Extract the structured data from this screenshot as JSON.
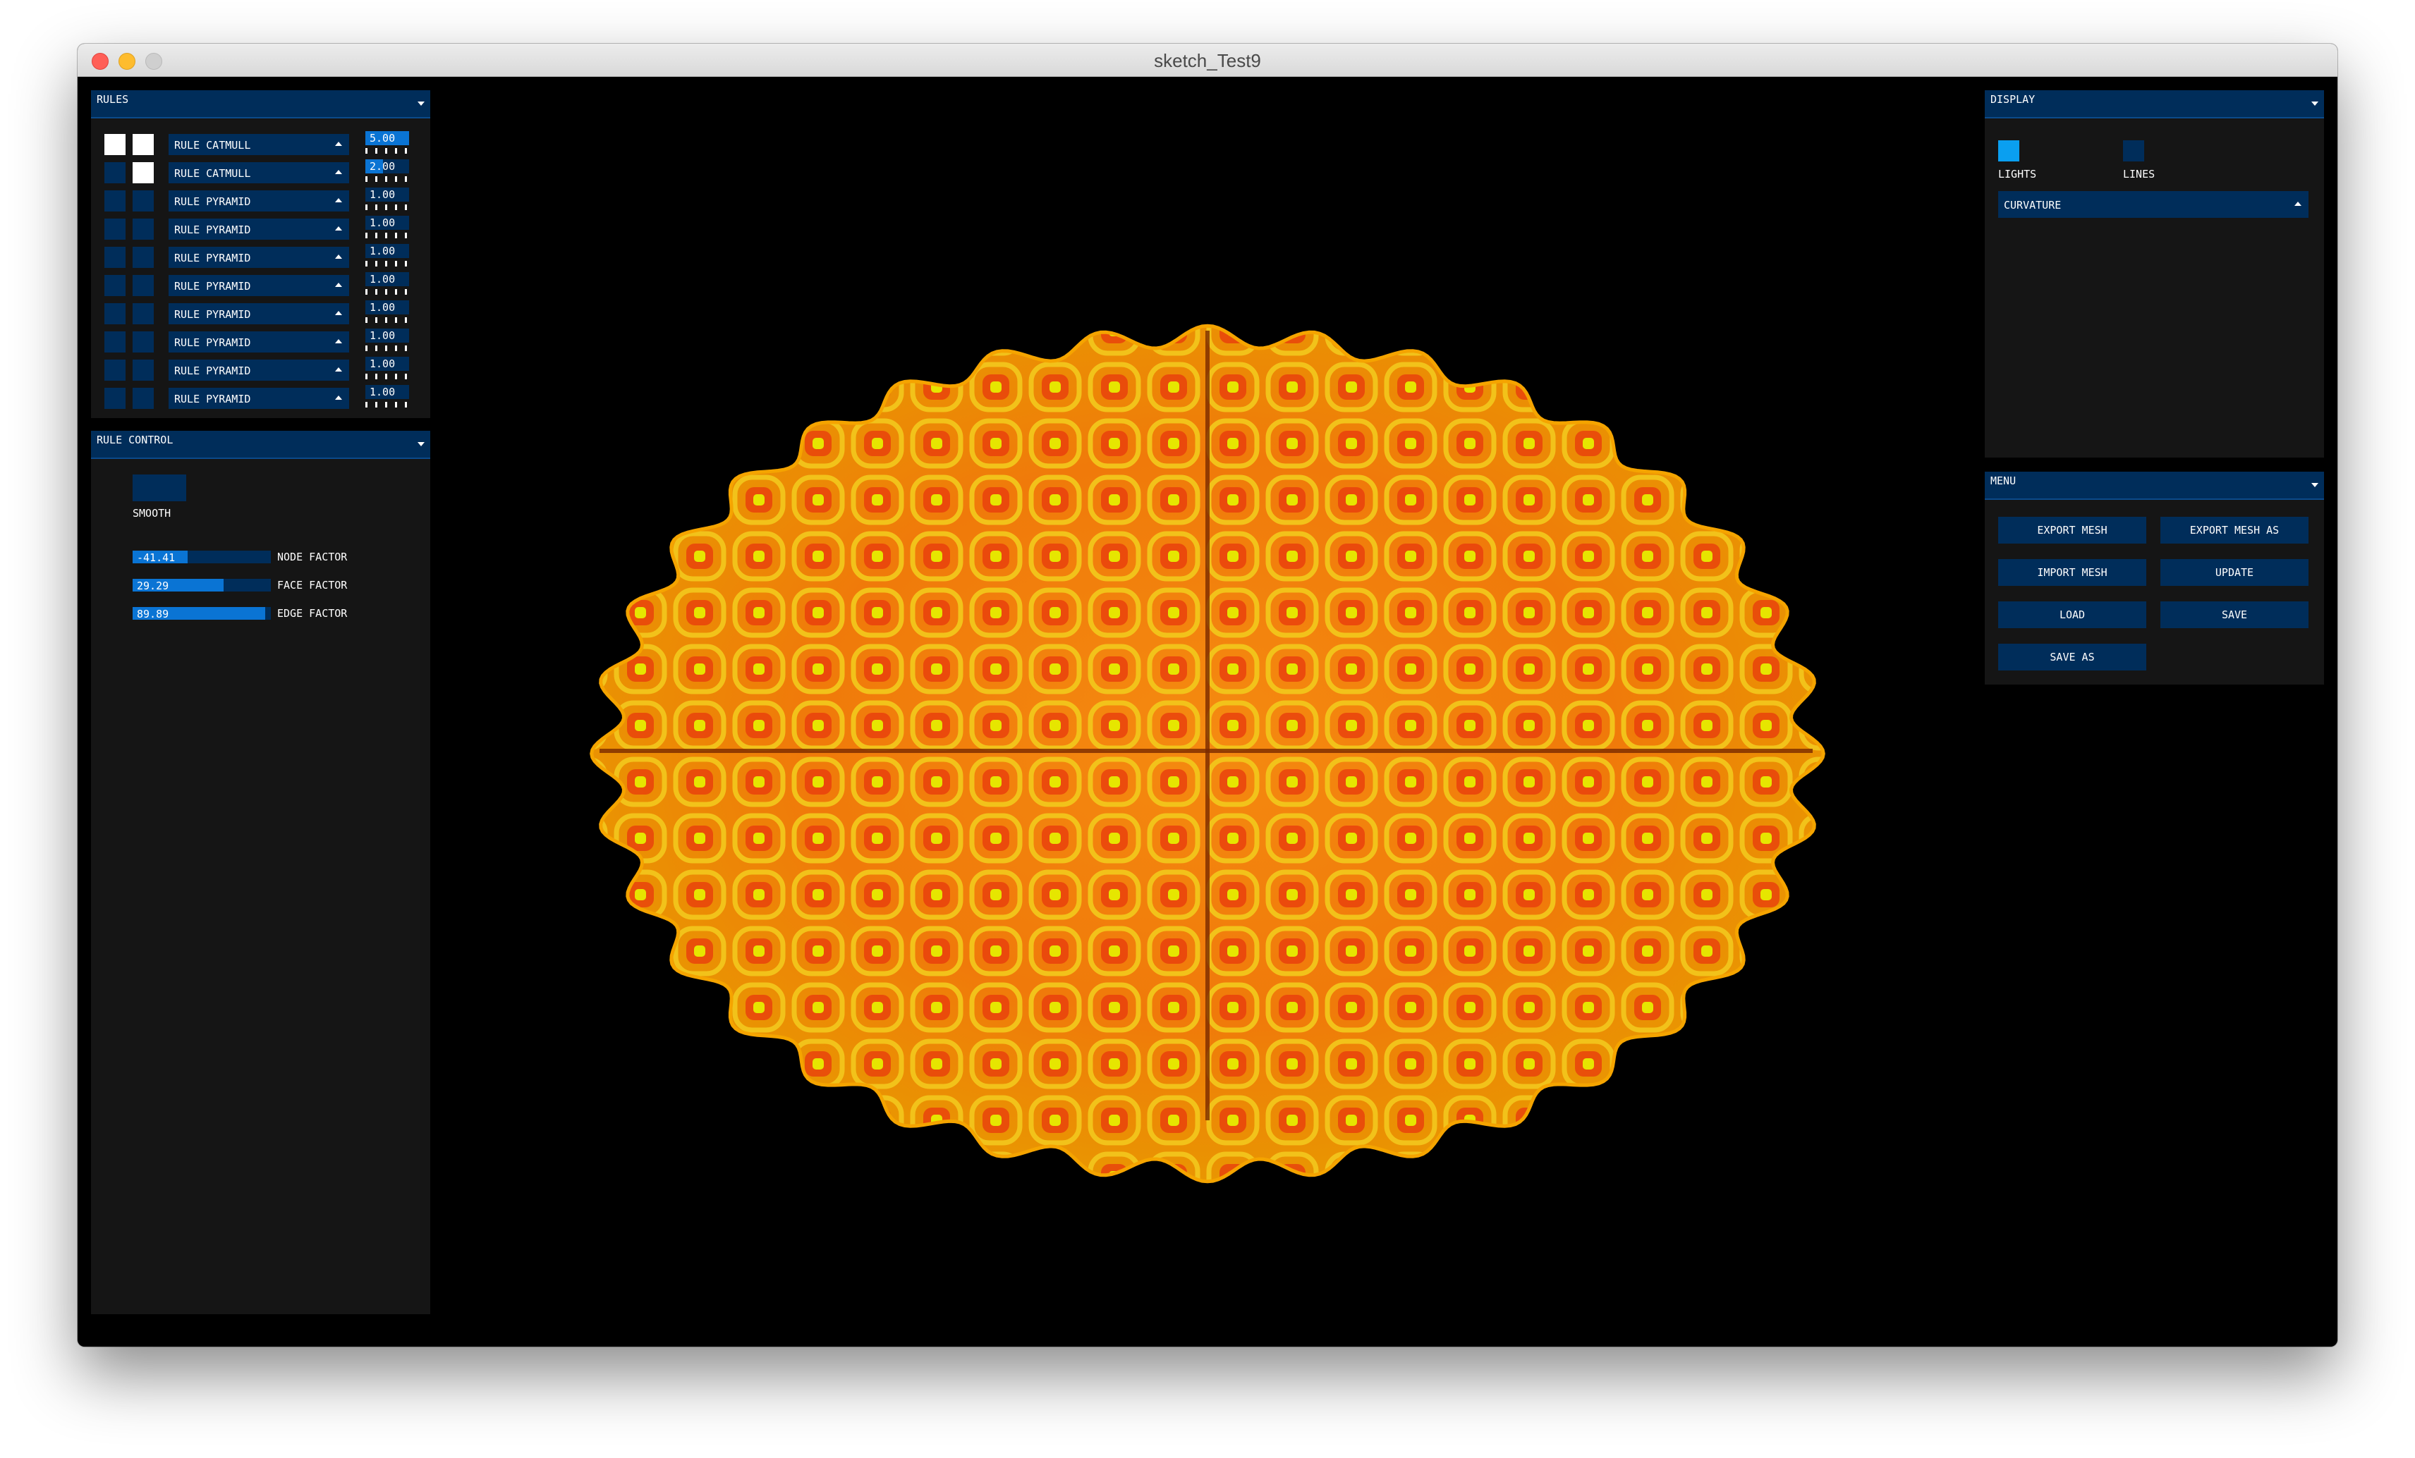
{
  "window": {
    "title": "sketch_Test9"
  },
  "rules_panel": {
    "header": "RULES",
    "rows": [
      {
        "check_a": true,
        "check_b": true,
        "rule": "RULE CATMULL",
        "value": "5.00",
        "fill": 1.0
      },
      {
        "check_a": false,
        "check_b": true,
        "rule": "RULE CATMULL",
        "value": "2.00",
        "fill": 0.4
      },
      {
        "check_a": false,
        "check_b": false,
        "rule": "RULE PYRAMID",
        "value": "1.00",
        "fill": 0.0
      },
      {
        "check_a": false,
        "check_b": false,
        "rule": "RULE PYRAMID",
        "value": "1.00",
        "fill": 0.0
      },
      {
        "check_a": false,
        "check_b": false,
        "rule": "RULE PYRAMID",
        "value": "1.00",
        "fill": 0.0
      },
      {
        "check_a": false,
        "check_b": false,
        "rule": "RULE PYRAMID",
        "value": "1.00",
        "fill": 0.0
      },
      {
        "check_a": false,
        "check_b": false,
        "rule": "RULE PYRAMID",
        "value": "1.00",
        "fill": 0.0
      },
      {
        "check_a": false,
        "check_b": false,
        "rule": "RULE PYRAMID",
        "value": "1.00",
        "fill": 0.0
      },
      {
        "check_a": false,
        "check_b": false,
        "rule": "RULE PYRAMID",
        "value": "1.00",
        "fill": 0.0
      },
      {
        "check_a": false,
        "check_b": false,
        "rule": "RULE PYRAMID",
        "value": "1.00",
        "fill": 0.0
      }
    ]
  },
  "rule_control": {
    "header": "RULE CONTROL",
    "smooth_label": "SMOOTH",
    "sliders": [
      {
        "value": "-41.41",
        "label": "NODE FACTOR",
        "fill": 0.4
      },
      {
        "value": "29.29",
        "label": "FACE FACTOR",
        "fill": 0.66
      },
      {
        "value": "89.89",
        "label": "EDGE FACTOR",
        "fill": 0.96
      }
    ]
  },
  "display_panel": {
    "header": "DISPLAY",
    "lights_label": "LIGHTS",
    "lights_on": true,
    "lines_label": "LINES",
    "lines_on": false,
    "mode": "CURVATURE"
  },
  "menu_panel": {
    "header": "MENU",
    "export_mesh": "EXPORT MESH",
    "export_mesh_as": "EXPORT MESH AS",
    "import_mesh": "IMPORT MESH",
    "update": "UPDATE",
    "load": "LOAD",
    "save": "SAVE",
    "save_as": "SAVE AS"
  },
  "colors": {
    "panel_bg": "#151515",
    "control_bg": "#002d5a",
    "accent": "#0a74d4",
    "toggle_on": "#0a9ff0",
    "mesh_orange": "#f07a0a",
    "mesh_yellow": "#e6e600",
    "mesh_red": "#e8380c"
  }
}
